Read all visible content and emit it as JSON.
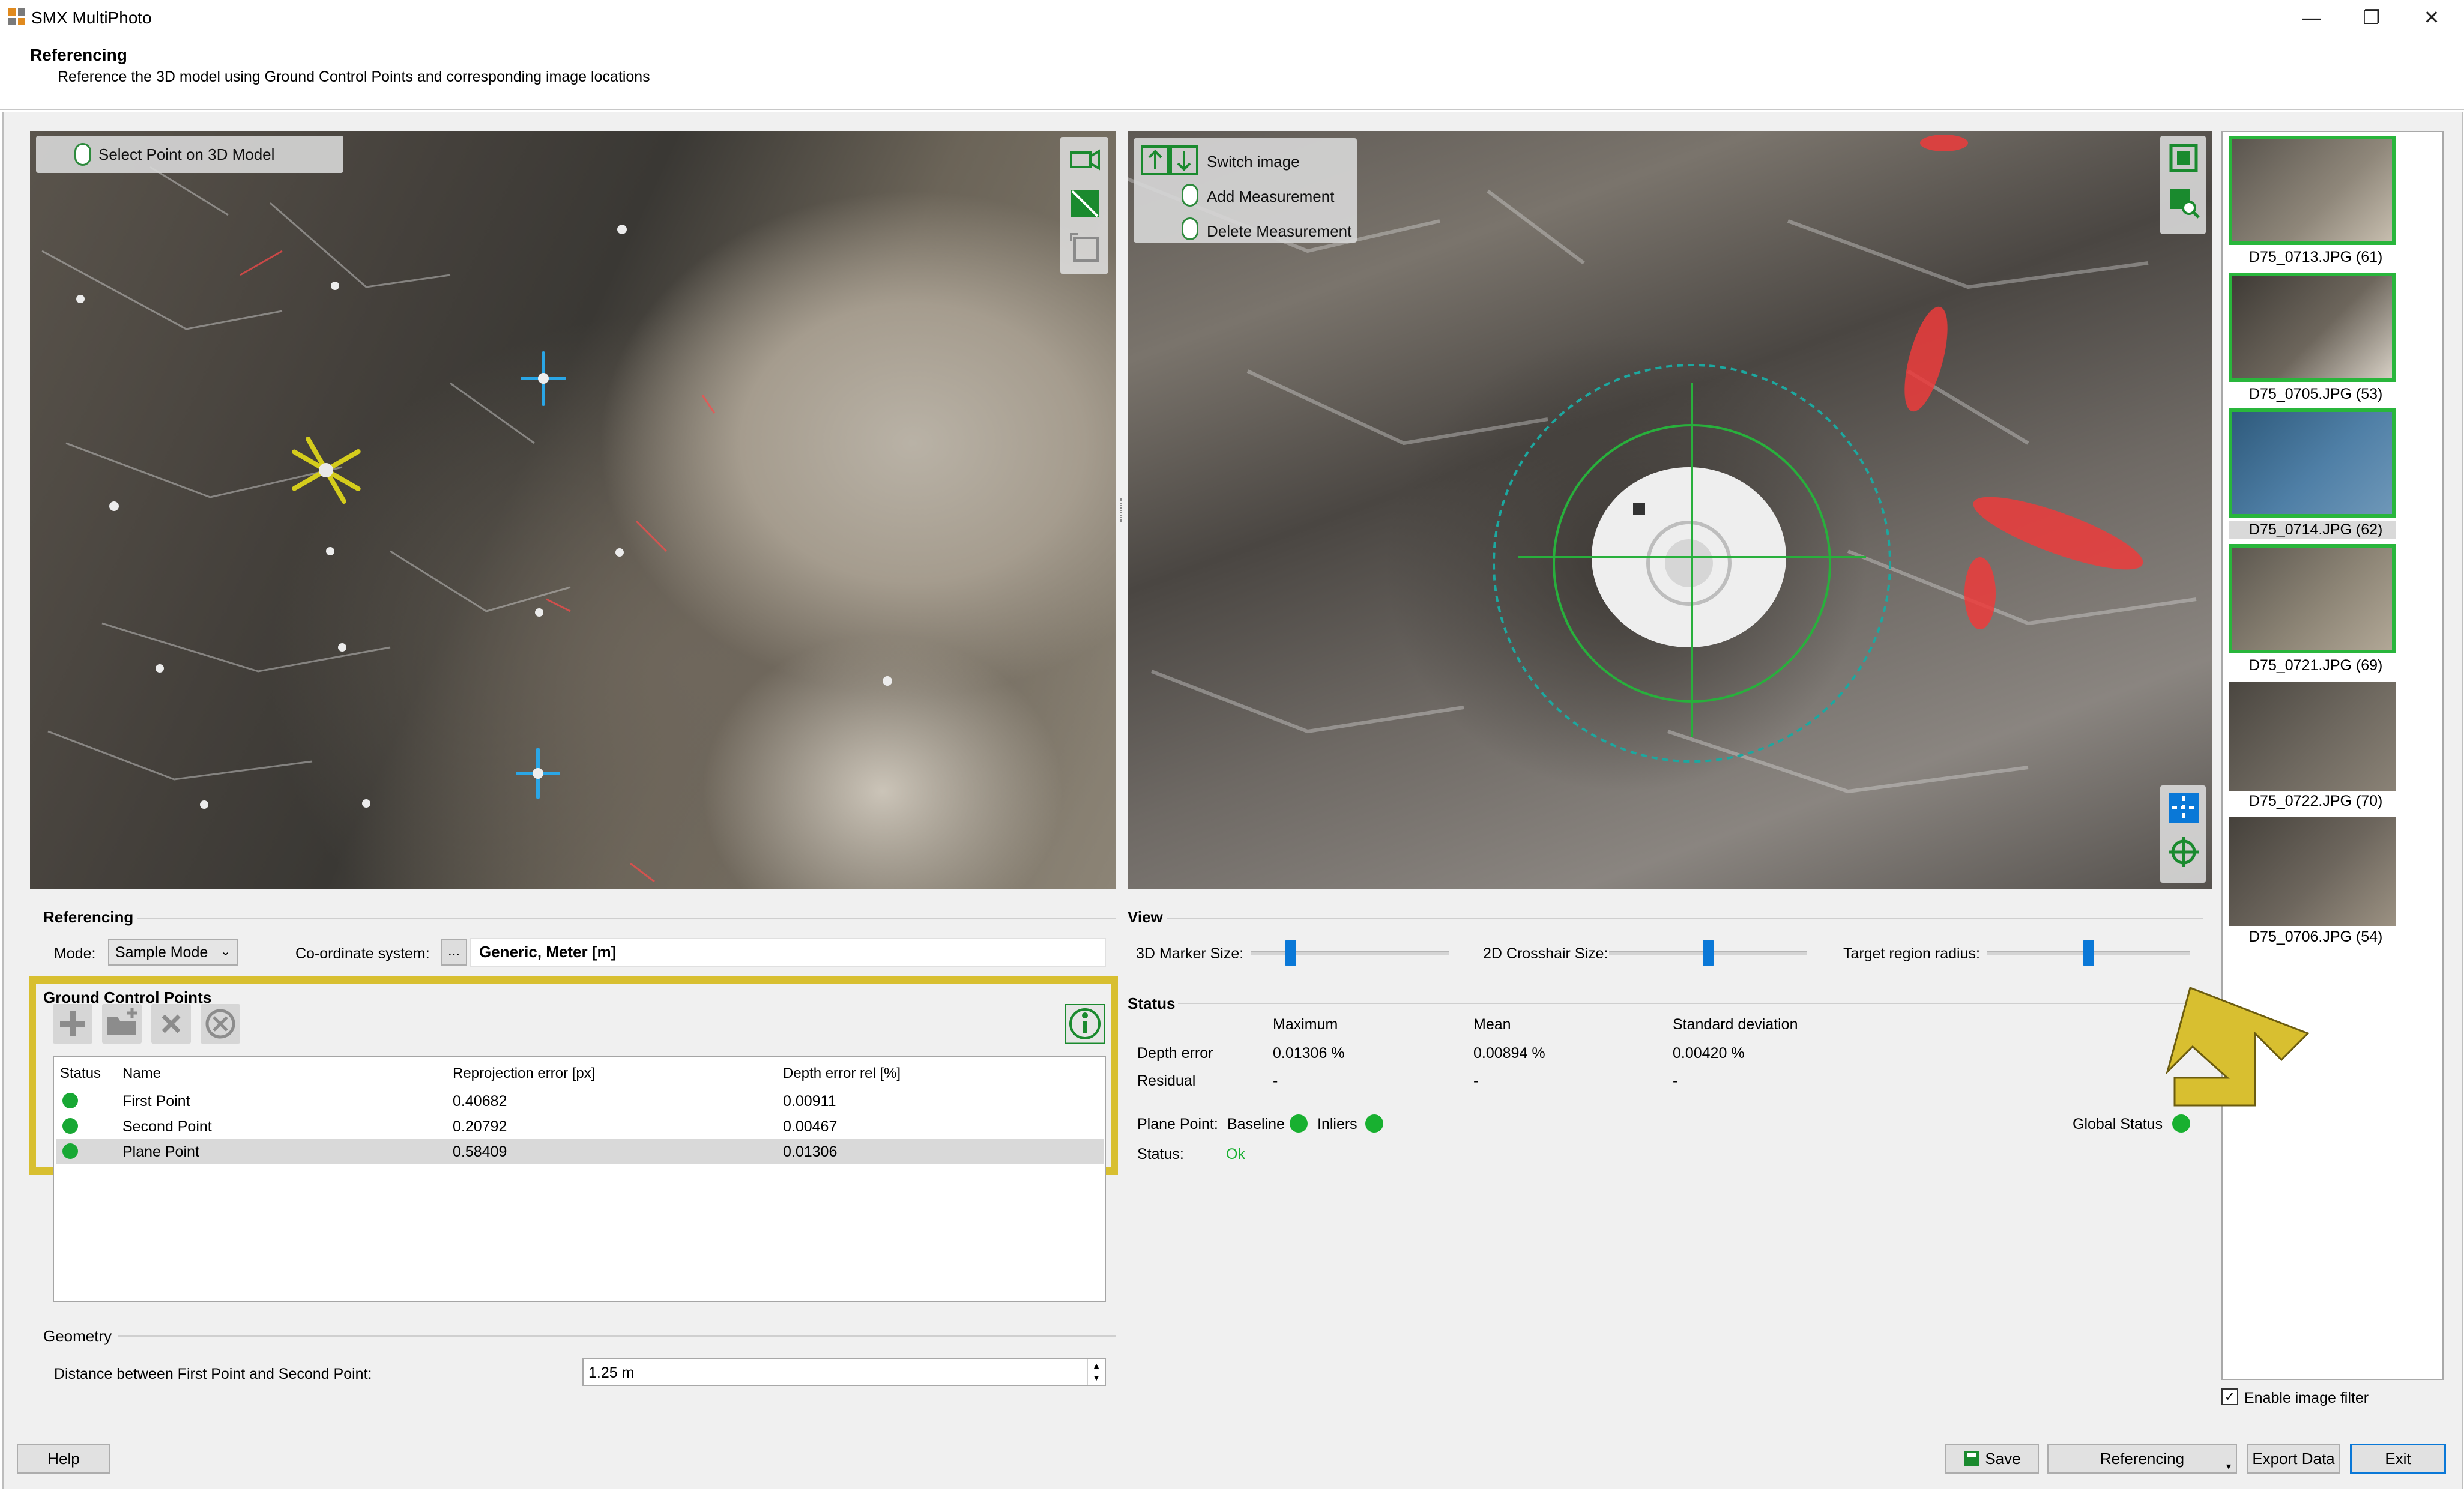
{
  "window": {
    "title": "SMX MultiPhoto",
    "controls": [
      "minimize-icon",
      "restore-icon",
      "close-icon"
    ]
  },
  "header": {
    "title": "Referencing",
    "subtitle": "Reference the 3D model using Ground Control Points and corresponding image locations"
  },
  "view3d": {
    "tooltip": "Select Point on 3D Model",
    "tools": [
      "camera-icon",
      "plane-icon",
      "crop-icon"
    ]
  },
  "view2d": {
    "hints": [
      "Switch image",
      "Add Measurement",
      "Delete Measurement"
    ],
    "tools_top": [
      "fit-view-icon",
      "zoom-region-icon"
    ],
    "tools_bottom": [
      "crosshair-icon",
      "target-icon"
    ]
  },
  "thumbnails": [
    {
      "label": "D75_0713.JPG (61)",
      "selected": true,
      "highlight": false
    },
    {
      "label": "D75_0705.JPG (53)",
      "selected": true,
      "highlight": false
    },
    {
      "label": "D75_0714.JPG (62)",
      "selected": true,
      "highlight": true
    },
    {
      "label": "D75_0721.JPG (69)",
      "selected": true,
      "highlight": false
    },
    {
      "label": "D75_0722.JPG (70)",
      "selected": false,
      "highlight": false
    },
    {
      "label": "D75_0706.JPG (54)",
      "selected": false,
      "highlight": false
    }
  ],
  "enable_image_filter": {
    "label": "Enable image filter",
    "checked": true
  },
  "referencing": {
    "section_title": "Referencing",
    "mode_label": "Mode:",
    "mode_value": "Sample Mode",
    "coord_label": "Co-ordinate system:",
    "coord_button": "...",
    "coord_value": "Generic, Meter [m]"
  },
  "gcp": {
    "title": "Ground Control Points",
    "toolbar": [
      "add-icon",
      "add-folder-icon",
      "delete-icon",
      "cancel-icon"
    ],
    "info_icon": "info-icon",
    "columns": [
      "Status",
      "Name",
      "Reprojection error [px]",
      "Depth error rel [%]"
    ],
    "rows": [
      {
        "status": "ok",
        "name": "First Point",
        "reproj": "0.40682",
        "depth": "0.00911",
        "selected": false
      },
      {
        "status": "ok",
        "name": "Second Point",
        "reproj": "0.20792",
        "depth": "0.00467",
        "selected": false
      },
      {
        "status": "ok",
        "name": "Plane Point",
        "reproj": "0.58409",
        "depth": "0.01306",
        "selected": true
      }
    ]
  },
  "geometry": {
    "section_title": "Geometry",
    "distance_label": "Distance between First Point and Second Point:",
    "distance_value": "1.25 m"
  },
  "view": {
    "section_title": "View",
    "marker_label": "3D Marker Size:",
    "marker_level": 0.2,
    "crosshair_label": "2D Crosshair Size:",
    "crosshair_level": 0.5,
    "target_label": "Target region radius:",
    "target_level": 0.5
  },
  "status": {
    "section_title": "Status",
    "col_max": "Maximum",
    "col_mean": "Mean",
    "col_std": "Standard deviation",
    "depth_label": "Depth error",
    "depth_max": "0.01306 %",
    "depth_mean": "0.00894 %",
    "depth_std": "0.00420 %",
    "residual_label": "Residual",
    "residual_max": "-",
    "residual_mean": "-",
    "residual_std": "-",
    "plane_label": "Plane Point:",
    "baseline_label": "Baseline",
    "inliers_label": "Inliers",
    "global_label": "Global Status",
    "status_label": "Status:",
    "status_value": "Ok",
    "ok_color": "#18b030"
  },
  "buttons": {
    "help": "Help",
    "save": "Save",
    "referencing": "Referencing",
    "export": "Export Data",
    "exit": "Exit"
  },
  "accent": "#0a78d7",
  "annotation_color": "#d8bf30"
}
